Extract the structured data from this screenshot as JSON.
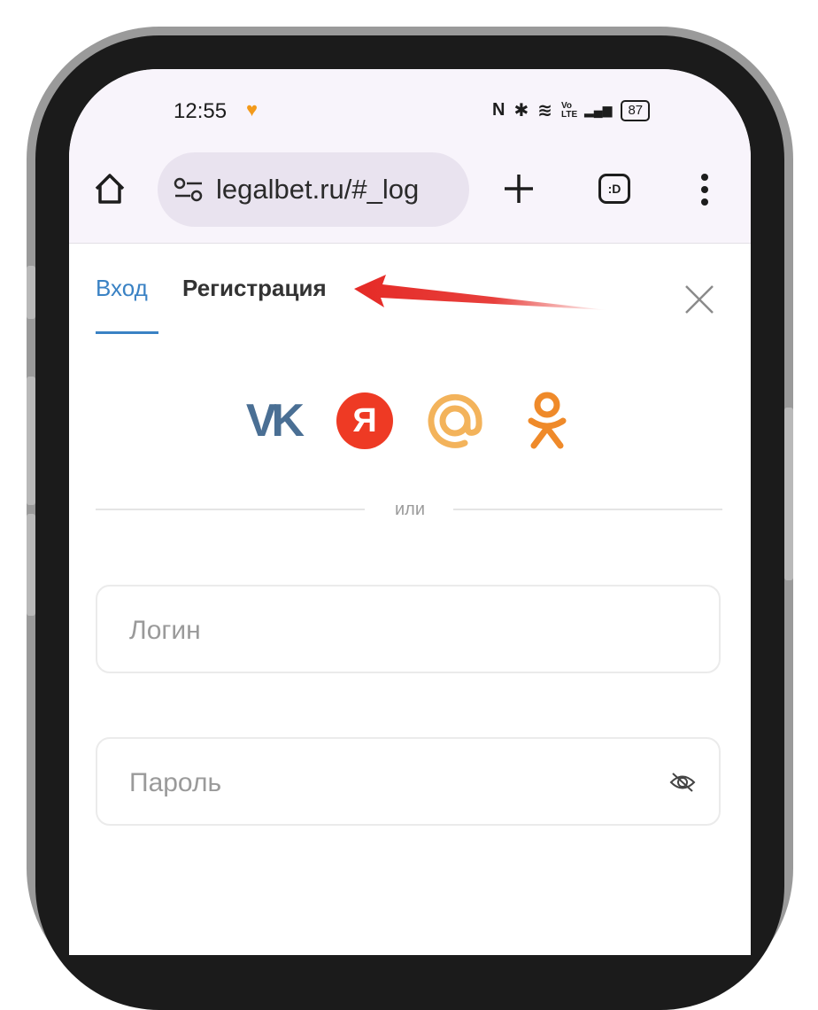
{
  "status_bar": {
    "time": "12:55",
    "heart_icon": "♥",
    "nfc_icon": "N",
    "bluetooth_icon": "✱",
    "wifi_icon": "≋",
    "volte_icon": "Vo LTE",
    "signal_icon": "▂▄▆",
    "battery": "87"
  },
  "browser": {
    "url": "legalbet.ru/#_log",
    "tabs_button_label": ":D"
  },
  "auth_tabs": {
    "login": "Вход",
    "register": "Регистрация"
  },
  "social_login": {
    "vk": "VK",
    "yandex": "Я"
  },
  "divider_text": "или",
  "form": {
    "login_placeholder": "Логин",
    "password_placeholder": "Пароль"
  },
  "colors": {
    "accent_blue": "#3a82c4",
    "vk": "#4a6f94",
    "yandex": "#ee3a24",
    "mail": "#f3b35b",
    "ok": "#ef8a2a",
    "arrow": "#e52a26"
  }
}
